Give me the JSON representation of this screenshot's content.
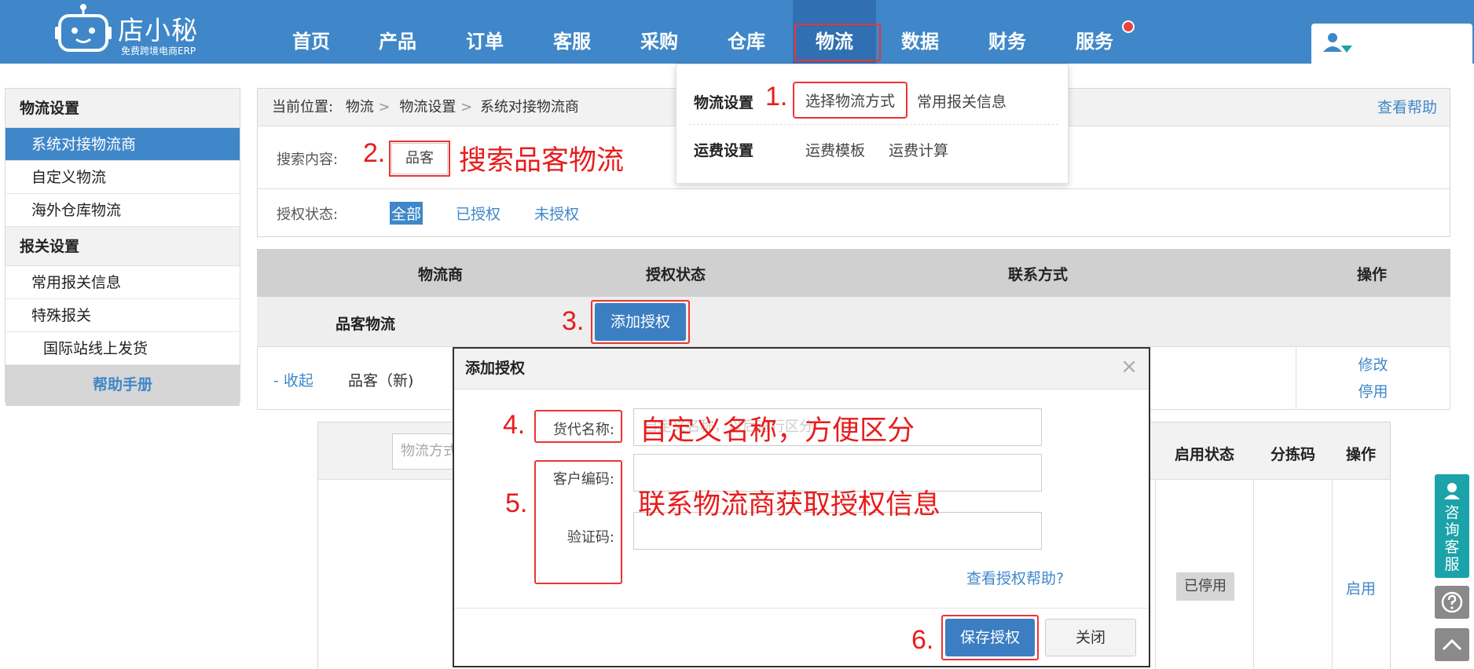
{
  "brand": {
    "name": "店小秘",
    "tagline": "免费跨境电商ERP"
  },
  "nav": {
    "items": [
      "首页",
      "产品",
      "订单",
      "客服",
      "采购",
      "仓库",
      "物流",
      "数据",
      "财务",
      "服务"
    ]
  },
  "dropdown": {
    "group1": {
      "title": "物流设置",
      "links": [
        "选择物流方式",
        "常用报关信息"
      ]
    },
    "group2": {
      "title": "运费设置",
      "links": [
        "运费模板",
        "运费计算"
      ]
    }
  },
  "sidebar": {
    "section1": "物流设置",
    "items1": [
      "系统对接物流商",
      "自定义物流",
      "海外仓库物流"
    ],
    "section2": "报关设置",
    "items2": [
      "常用报关信息",
      "特殊报关"
    ],
    "sub_item": "国际站线上发货",
    "help": "帮助手册"
  },
  "breadcrumb": {
    "prefix": "当前位置:",
    "p1": "物流",
    "p2": "物流设置",
    "p3": "系统对接物流商",
    "sep": ">"
  },
  "help_link": "查看帮助",
  "search": {
    "label": "搜索内容:",
    "value": "品客"
  },
  "auth_filter": {
    "label": "授权状态:",
    "options": [
      "全部",
      "已授权",
      "未授权"
    ]
  },
  "table": {
    "headers": [
      "物流商",
      "授权状态",
      "联系方式",
      "操作"
    ],
    "group_name": "品客物流",
    "add_auth_button": "添加授权",
    "row": {
      "collapse": "- 收起",
      "name": "品客（新)",
      "ops": [
        "修改",
        "停用"
      ]
    }
  },
  "inner": {
    "search_placeholder": "物流方式",
    "headers": [
      "启用状态",
      "分拣码",
      "操作"
    ],
    "status_badge": "已停用",
    "enable_link": "启用"
  },
  "modal": {
    "title": "添加授权",
    "close": "×",
    "fields": [
      {
        "label": "货代名称:",
        "placeholder": "自定义名称，以后进行区分"
      },
      {
        "label": "客户编码:",
        "placeholder": ""
      },
      {
        "label": "验证码:",
        "placeholder": ""
      }
    ],
    "help": "查看授权帮助?",
    "save_button": "保存授权",
    "close_button": "关闭"
  },
  "annotations": {
    "n1": "1.",
    "n2": "2.",
    "n3": "3.",
    "n4": "4.",
    "n5": "5.",
    "n6": "6.",
    "search_note": "搜索品客物流",
    "name_note": "自定义名称，方便区分",
    "contact_note": "联系物流商获取授权信息"
  },
  "float": {
    "consult": [
      "咨",
      "询",
      "客",
      "服"
    ]
  },
  "colors": {
    "primary": "#3f87c9",
    "annotation": "#e81c1c",
    "consult": "#1aa3a9"
  }
}
